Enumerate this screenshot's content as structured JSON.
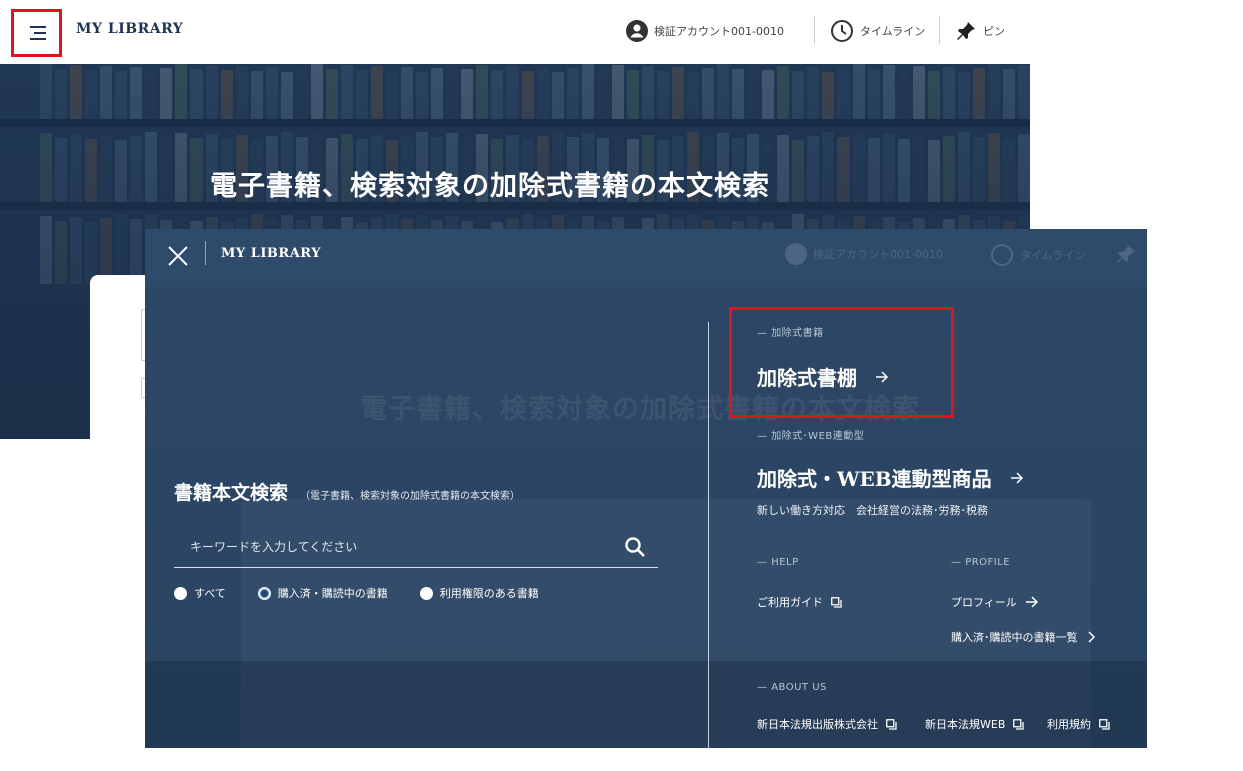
{
  "header": {
    "brand": "MY LIBRARY",
    "account": "検証アカウント001-0010",
    "timeline": "タイムライン",
    "pin": "ピン"
  },
  "hero": {
    "title": "電子書籍、検索対象の加除式書籍の本文検索"
  },
  "menu": {
    "brand": "MY LIBRARY",
    "search": {
      "title": "書籍本文検索",
      "subtitle": "（電子書籍、検索対象の加除式書籍の本文検索）",
      "placeholder": "キーワードを入力してください",
      "radios": [
        {
          "label": "すべて",
          "selected": false
        },
        {
          "label": "購入済・購読中の書籍",
          "selected": true
        },
        {
          "label": "利用権限のある書籍",
          "selected": false
        }
      ]
    },
    "shelf": {
      "section": "加除式書籍",
      "link": "加除式書棚"
    },
    "web": {
      "section": "加除式･WEB連動型",
      "link": "加除式・WEB連動型商品",
      "tagline": "新しい働き方対応　会社経営の法務･労務･税務"
    },
    "help": {
      "section": "HELP",
      "guide": "ご利用ガイド"
    },
    "profile": {
      "section": "PROFILE",
      "profile": "プロフィール",
      "purchased": "購入済･購読中の書籍一覧"
    },
    "about": {
      "section": "ABOUT US",
      "links": [
        "新日本法規出版株式会社",
        "新日本法規WEB",
        "利用規約"
      ]
    }
  },
  "colors": {
    "overlay": "#2a4461",
    "highlight": "#e0141e",
    "brand_text": "#1e3350"
  }
}
